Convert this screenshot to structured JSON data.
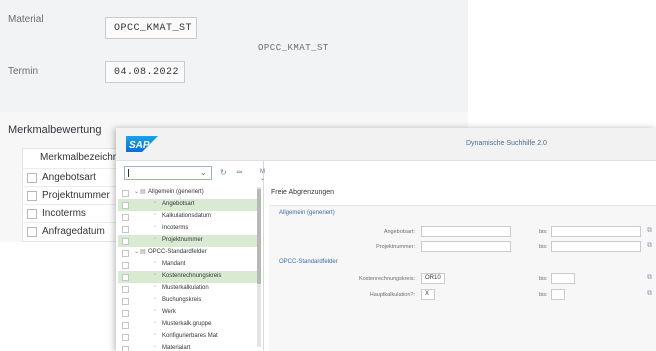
{
  "background": {
    "material": {
      "label": "Material",
      "value": "OPCC_KMAT_ST",
      "description": "OPCC_KMAT_ST"
    },
    "termin": {
      "label": "Termin",
      "value": "04.08.2022"
    },
    "section_title": "Merkmalbewertung",
    "table_header": "Merkmalbezeichr",
    "rows": [
      "Angebotsart",
      "Projektnummer",
      "Incoterms",
      "Anfragedatum"
    ]
  },
  "dialog": {
    "title": "Dynamische Suchhilfe 2.0",
    "search_value": "",
    "toolbar_more": "Mehr",
    "tree": [
      {
        "label": "Allgemein (generiert)",
        "level": 0,
        "expandable": true,
        "selected": false
      },
      {
        "label": "Angebotsart",
        "level": 1,
        "expandable": false,
        "selected": true
      },
      {
        "label": "Kalkulationsdatum",
        "level": 1,
        "expandable": false,
        "selected": false
      },
      {
        "label": "Incoterms",
        "level": 1,
        "expandable": false,
        "selected": false
      },
      {
        "label": "Projektnummer",
        "level": 1,
        "expandable": false,
        "selected": true
      },
      {
        "label": "OPCC-Standardfelder",
        "level": 0,
        "expandable": true,
        "selected": false
      },
      {
        "label": "Mandant",
        "level": 1,
        "expandable": false,
        "selected": false
      },
      {
        "label": "Kostenrechnungskreis",
        "level": 1,
        "expandable": false,
        "selected": true
      },
      {
        "label": "Musterkalkulation",
        "level": 1,
        "expandable": false,
        "selected": false
      },
      {
        "label": "Buchungskreis",
        "level": 1,
        "expandable": false,
        "selected": false
      },
      {
        "label": "Werk",
        "level": 1,
        "expandable": false,
        "selected": false
      },
      {
        "label": "Musterkalk.gruppe",
        "level": 1,
        "expandable": false,
        "selected": false
      },
      {
        "label": "Konfigurierbares Mat",
        "level": 1,
        "expandable": false,
        "selected": false
      },
      {
        "label": "Materialart",
        "level": 1,
        "expandable": false,
        "selected": false
      }
    ],
    "freie_title": "Freie Abgrenzungen",
    "groups": [
      {
        "title": "Allgemein (generiert)",
        "fields": [
          {
            "label": "Angebotsart:",
            "from": "",
            "to_label": "bis:",
            "to": ""
          },
          {
            "label": "Projektnummer:",
            "from": "",
            "to_label": "bis:",
            "to": ""
          }
        ]
      },
      {
        "title": "OPCC-Standardfelder",
        "fields": [
          {
            "label": "Kostenrechnungskreis:",
            "from": "OR10",
            "to_label": "bis:",
            "to": ""
          },
          {
            "label": "Hauptkalkulation?:",
            "from": "X",
            "to_label": "bis:",
            "to": ""
          }
        ]
      }
    ]
  },
  "colors": {
    "accent": "#3a6ea5",
    "selected_row": "#d8ead1",
    "sap_blue": "#0a6ed1"
  }
}
